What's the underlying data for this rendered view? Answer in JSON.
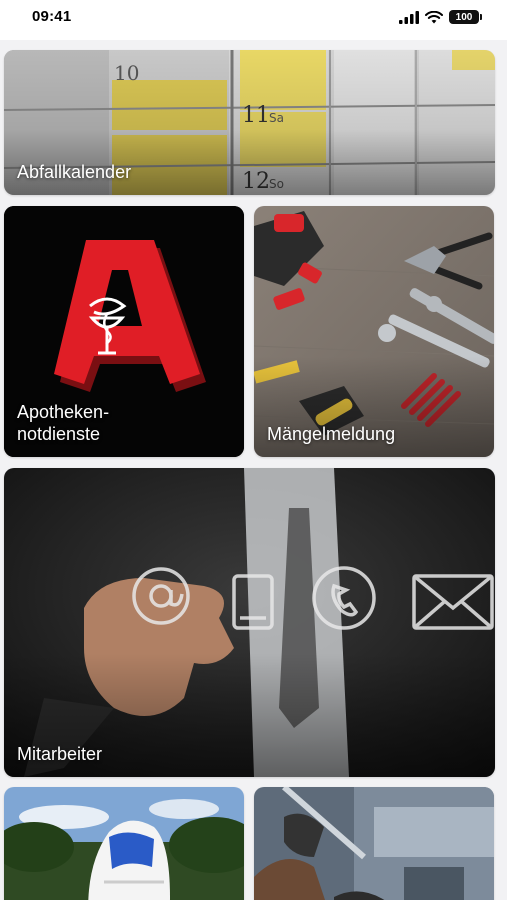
{
  "status_bar": {
    "time": "09:41",
    "battery": "100"
  },
  "tiles": {
    "abfallkalender": {
      "label": "Abfallkalender"
    },
    "apotheken": {
      "label": "Apotheken-\nnotdienste"
    },
    "maengelmeldung": {
      "label": "Mängelmeldung"
    },
    "mitarbeiter": {
      "label": "Mitarbeiter"
    }
  },
  "calendar_numbers": [
    "10",
    "11",
    "Sa",
    "12",
    "So"
  ]
}
